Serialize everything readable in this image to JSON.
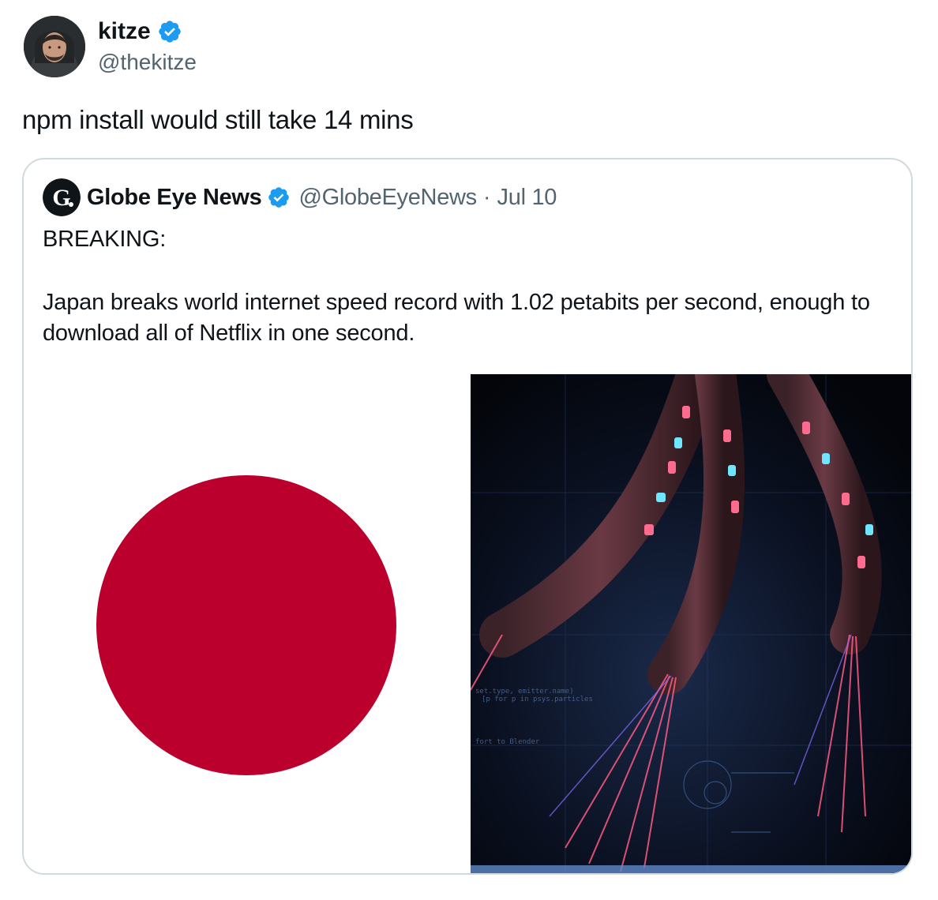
{
  "author": {
    "name": "kitze",
    "handle": "@thekitze",
    "verified": true,
    "avatar_icon": "person-avatar-icon"
  },
  "tweet": {
    "text": "npm install would still take 14 mins"
  },
  "quoted": {
    "name": "Globe Eye News",
    "handle": "@GlobeEyeNews",
    "separator": "·",
    "date": "Jul 10",
    "verified": true,
    "logo_icon": "globe-eye-logo-icon",
    "lines": {
      "breaking": "BREAKING:",
      "body": "Japan breaks world internet speed record with 1.02 petabits per second, enough to download all of Netflix in one second."
    },
    "media": [
      {
        "kind": "japan-flag-image",
        "colors": {
          "field": "#ffffff",
          "sun": "#bc002d"
        }
      },
      {
        "kind": "fiber-optic-cables-image",
        "colors": {
          "background": "#04070d",
          "pink": "#ff4d7a",
          "cyan": "#5be3ff"
        }
      }
    ]
  },
  "colors": {
    "text": "#0f1419",
    "secondary": "#536471",
    "verified": "#1d9bf0",
    "border": "#cfd9de"
  }
}
